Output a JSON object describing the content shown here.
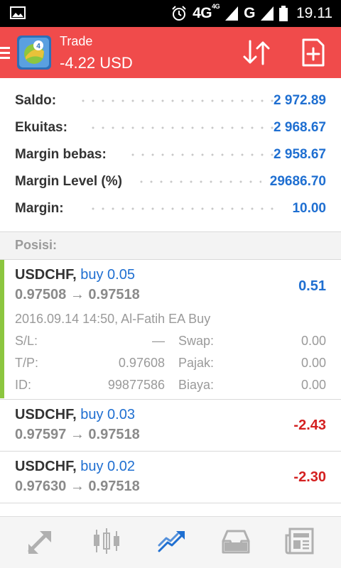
{
  "status_bar": {
    "network": "4G",
    "network_sup": "4G",
    "carrier_type": "G",
    "time": "19.11"
  },
  "header": {
    "title": "Trade",
    "subtitle": "-4.22 USD"
  },
  "summary": [
    {
      "label": "Saldo:",
      "value": "2 972.89"
    },
    {
      "label": "Ekuitas:",
      "value": "2 968.67"
    },
    {
      "label": "Margin bebas:",
      "value": "2 958.67"
    },
    {
      "label": "Margin Level (%)",
      "value": "29686.70"
    },
    {
      "label": "Margin:",
      "value": "10.00"
    }
  ],
  "section_title": "Posisi:",
  "positions": [
    {
      "symbol": "USDCHF,",
      "side": "buy 0.05",
      "prices": "0.97508 → 0.97518",
      "profit": "0.51",
      "detail": {
        "datetime": "2016.09.14 14:50, Al-Fatih EA Buy",
        "sl_label": "S/L:",
        "sl_value": "—",
        "tp_label": "T/P:",
        "tp_value": "0.97608",
        "id_label": "ID:",
        "id_value": "99877586",
        "swap_label": "Swap:",
        "swap_value": "0.00",
        "tax_label": "Pajak:",
        "tax_value": "0.00",
        "fee_label": "Biaya:",
        "fee_value": "0.00"
      }
    },
    {
      "symbol": "USDCHF,",
      "side": "buy 0.03",
      "prices": "0.97597 → 0.97518",
      "profit": "-2.43"
    },
    {
      "symbol": "USDCHF,",
      "side": "buy 0.02",
      "prices": "0.97630 → 0.97518",
      "profit": "-2.30"
    }
  ],
  "colors": {
    "header": "#f04b4b",
    "accent_blue": "#1f6fd1",
    "loss_red": "#d42020",
    "expanded_bar": "#8cc63f"
  },
  "bottom_nav": [
    {
      "icon": "quotes-icon"
    },
    {
      "icon": "chart-icon"
    },
    {
      "icon": "trade-icon"
    },
    {
      "icon": "history-icon"
    },
    {
      "icon": "news-icon"
    }
  ]
}
